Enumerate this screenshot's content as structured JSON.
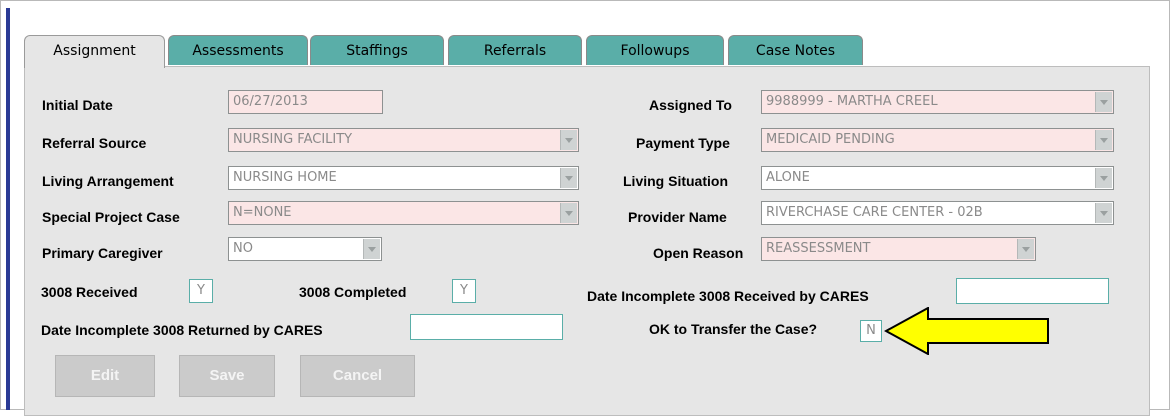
{
  "tabs": [
    {
      "label": "Assignment",
      "active": true
    },
    {
      "label": "Assessments",
      "active": false
    },
    {
      "label": "Staffings",
      "active": false
    },
    {
      "label": "Referrals",
      "active": false
    },
    {
      "label": "Followups",
      "active": false
    },
    {
      "label": "Case Notes",
      "active": false
    }
  ],
  "form": {
    "initial_date": {
      "label": "Initial Date",
      "value": "06/27/2013"
    },
    "referral_source": {
      "label": "Referral Source",
      "value": "NURSING FACILITY"
    },
    "living_arrangement": {
      "label": "Living Arrangement",
      "value": "NURSING HOME"
    },
    "special_project_case": {
      "label": "Special Project Case",
      "value": "N=NONE"
    },
    "primary_caregiver": {
      "label": "Primary Caregiver",
      "value": "NO"
    },
    "assigned_to": {
      "label": "Assigned To",
      "value": "9988999 - MARTHA CREEL"
    },
    "payment_type": {
      "label": "Payment Type",
      "value": "MEDICAID PENDING"
    },
    "living_situation": {
      "label": "Living Situation",
      "value": "ALONE"
    },
    "provider_name": {
      "label": "Provider Name",
      "value": "RIVERCHASE CARE CENTER - 02B"
    },
    "open_reason": {
      "label": "Open Reason",
      "value": "REASSESSMENT"
    },
    "received_3008": {
      "label": "3008 Received",
      "value": "Y"
    },
    "completed_3008": {
      "label": "3008 Completed",
      "value": "Y"
    },
    "date_incomplete_received": {
      "label": "Date Incomplete 3008 Received by CARES",
      "value": ""
    },
    "date_incomplete_returned": {
      "label": "Date Incomplete 3008 Returned by CARES",
      "value": ""
    },
    "ok_to_transfer": {
      "label": "OK to Transfer the Case?",
      "value": "N"
    }
  },
  "buttons": {
    "edit": "Edit",
    "save": "Save",
    "cancel": "Cancel"
  },
  "colors": {
    "tab": "#5aaea8",
    "panel": "#e6e6e6",
    "required_field": "#fbe6e6",
    "arrow": "#ffff00",
    "left_bar": "#2a3a95"
  },
  "annotation": {
    "icon": "arrow-left-icon",
    "color": "#ffff00"
  }
}
